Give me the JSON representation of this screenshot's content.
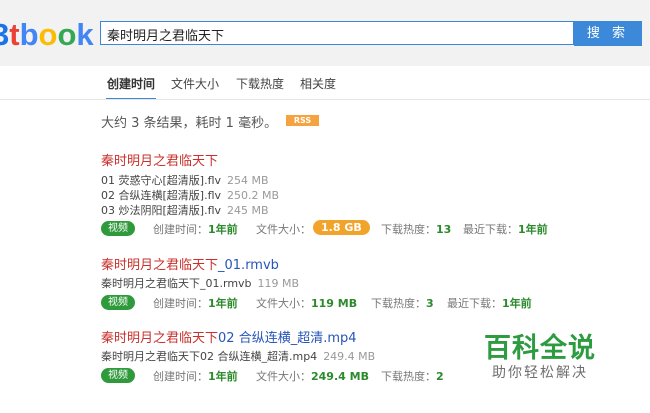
{
  "logo": {
    "text": "3tbook",
    "colors": [
      "#1a73e8",
      "#ea4335",
      "#4285f4",
      "#fbbc05",
      "#34a853",
      "#4285f4"
    ]
  },
  "search": {
    "query": "秦时明月之君临天下",
    "button": "搜 索"
  },
  "tabs": [
    "创建时间",
    "文件大小",
    "下载热度",
    "相关度"
  ],
  "summary": "大约 3 条结果，耗时 1 毫秒。",
  "rss_label": "RSS",
  "results": [
    {
      "title": "秦时明月之君临天下",
      "files": [
        {
          "name": "01 荧惑守心[超清版].flv",
          "size": "254 MB"
        },
        {
          "name": "02 合纵连横[超清版].flv",
          "size": "250.2 MB"
        },
        {
          "name": "03 炒法阴阳[超清版].flv",
          "size": "245 MB"
        }
      ],
      "type": "视频",
      "created_label": "创建时间：",
      "created": "1年前",
      "size_label": "文件大小：",
      "size": "1.8 GB",
      "hot_label": "下载热度：",
      "hot": "13",
      "recent_label": "最近下载：",
      "recent": "1年前"
    },
    {
      "title": "秦时明月之君临天下",
      "title_suffix": "_01.rmvb",
      "files": [
        {
          "name": "秦时明月之君临天下_01.rmvb",
          "size": "119 MB"
        }
      ],
      "type": "视频",
      "created_label": "创建时间：",
      "created": "1年前",
      "size_label": "文件大小：",
      "size": "119 MB",
      "hot_label": "下载热度：",
      "hot": "3",
      "recent_label": "最近下载：",
      "recent": "1年前"
    },
    {
      "title": "秦时明月之君临天下",
      "title_suffix": "02 合纵连横_超清.mp4",
      "files": [
        {
          "name": "秦时明月之君临天下02 合纵连横_超清.mp4",
          "size": "249.4 MB"
        }
      ],
      "type": "视频",
      "created_label": "创建时间：",
      "created": "1年前",
      "size_label": "文件大小：",
      "size": "249.4 MB",
      "hot_label": "下载热度：",
      "hot": "2"
    }
  ],
  "watermark": {
    "title": "百科全说",
    "subtitle": "助你轻松解决"
  }
}
